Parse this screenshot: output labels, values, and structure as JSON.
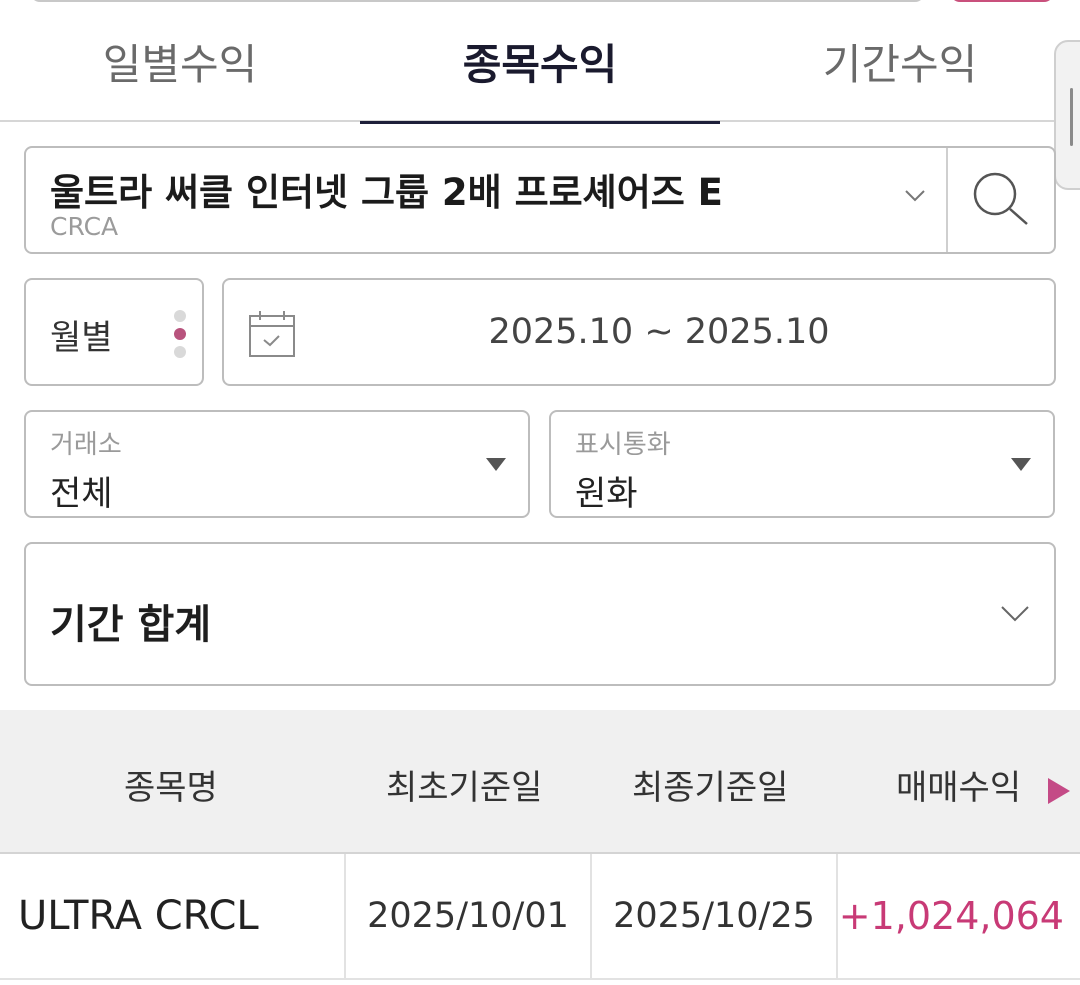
{
  "tabs": [
    {
      "label": "일별수익",
      "active": false
    },
    {
      "label": "종목수익",
      "active": true
    },
    {
      "label": "기간수익",
      "active": false
    }
  ],
  "product": {
    "name": "울트라 써클 인터넷 그룹 2배 프로셰어즈 E",
    "code": "CRCA"
  },
  "period": {
    "mode_label": "월별",
    "range": "2025.10 ~ 2025.10"
  },
  "filters": {
    "exchange": {
      "label": "거래소",
      "value": "전체"
    },
    "currency": {
      "label": "표시통화",
      "value": "원화"
    }
  },
  "summary": {
    "label": "기간 합계"
  },
  "table": {
    "headers": [
      "종목명",
      "최초기준일",
      "최종기준일",
      "매매수익"
    ],
    "rows": [
      {
        "name": "ULTRA CRCL",
        "start_date": "2025/10/01",
        "end_date": "2025/10/25",
        "profit": "+1,024,064"
      }
    ]
  },
  "colors": {
    "accent": "#c83a76",
    "active_tab": "#1e1f3a"
  }
}
